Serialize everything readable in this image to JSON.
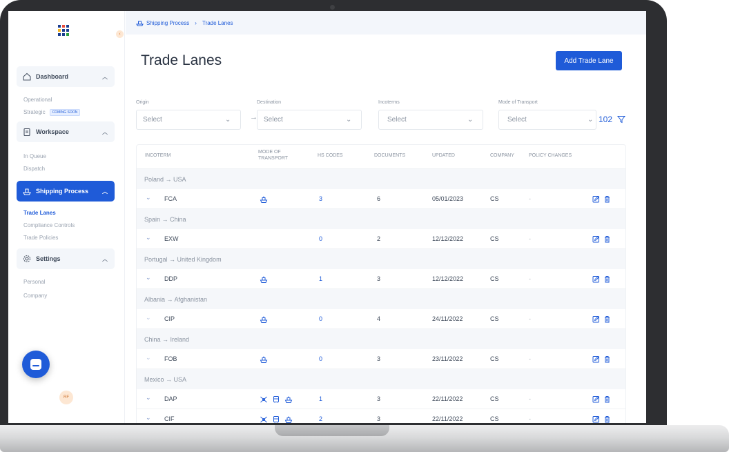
{
  "sidebar": {
    "sections": [
      {
        "label": "Dashboard",
        "items": [
          "Operational",
          "Strategic"
        ]
      },
      {
        "label": "Workspace",
        "items": [
          "In Queue",
          "Dispatch"
        ]
      },
      {
        "label": "Shipping Process",
        "items": [
          "Trade Lanes",
          "Compliance Controls",
          "Trade Policies"
        ]
      },
      {
        "label": "Settings",
        "items": [
          "Personal",
          "Company"
        ]
      }
    ],
    "coming_soon": "COMING SOON",
    "avatar": "RF"
  },
  "breadcrumb": {
    "root": "Shipping Process",
    "current": "Trade Lanes"
  },
  "page": {
    "title": "Trade Lanes",
    "add_button": "Add Trade Lane"
  },
  "filters": {
    "origin": {
      "label": "Origin",
      "value": "Select"
    },
    "destination": {
      "label": "Destination",
      "value": "Select"
    },
    "incoterms": {
      "label": "Incoterms",
      "value": "Select"
    },
    "mode": {
      "label": "Mode of Transport",
      "value": "Select"
    },
    "count": "102"
  },
  "table": {
    "headers": {
      "incoterm": "INCOTERM",
      "mode_1": "MODE OF",
      "mode_2": "TRANSPORT",
      "hs_codes": "HS CODES",
      "documents": "DOCUMENTS",
      "updated": "UPDATED",
      "company": "COMPANY",
      "policy": "POLICY CHANGES"
    },
    "groups": [
      {
        "lane": "Poland → USA",
        "rows": [
          {
            "incoterm": "FCA",
            "hs": "3",
            "docs": "6",
            "updated": "05/01/2023",
            "company": "CS",
            "policy": "-"
          }
        ]
      },
      {
        "lane": "Spain → China",
        "rows": [
          {
            "incoterm": "EXW",
            "hs": "0",
            "docs": "2",
            "updated": "12/12/2022",
            "company": "CS",
            "policy": "-"
          }
        ]
      },
      {
        "lane": "Portugal → United Kingdom",
        "rows": [
          {
            "incoterm": "DDP",
            "hs": "1",
            "docs": "3",
            "updated": "12/12/2022",
            "company": "CS",
            "policy": "-"
          }
        ]
      },
      {
        "lane": "Albania → Afghanistan",
        "rows": [
          {
            "incoterm": "CIP",
            "hs": "0",
            "docs": "4",
            "updated": "24/11/2022",
            "company": "CS",
            "policy": "-"
          }
        ]
      },
      {
        "lane": "China → Ireland",
        "rows": [
          {
            "incoterm": "FOB",
            "hs": "0",
            "docs": "3",
            "updated": "23/11/2022",
            "company": "CS",
            "policy": "-"
          }
        ]
      },
      {
        "lane": "Mexico → USA",
        "rows": [
          {
            "incoterm": "DAP",
            "hs": "1",
            "docs": "3",
            "updated": "22/11/2022",
            "company": "CS",
            "policy": "-"
          },
          {
            "incoterm": "CIF",
            "hs": "2",
            "docs": "3",
            "updated": "22/11/2022",
            "company": "CS",
            "policy": "-"
          }
        ]
      }
    ]
  },
  "icons": {
    "ship": "ship-icon",
    "plane": "plane-icon",
    "truck": "truck-icon",
    "edit": "edit-icon",
    "delete": "trash-icon"
  },
  "colors": {
    "accent": "#1f5bd8",
    "frame": "#2d2e31"
  }
}
